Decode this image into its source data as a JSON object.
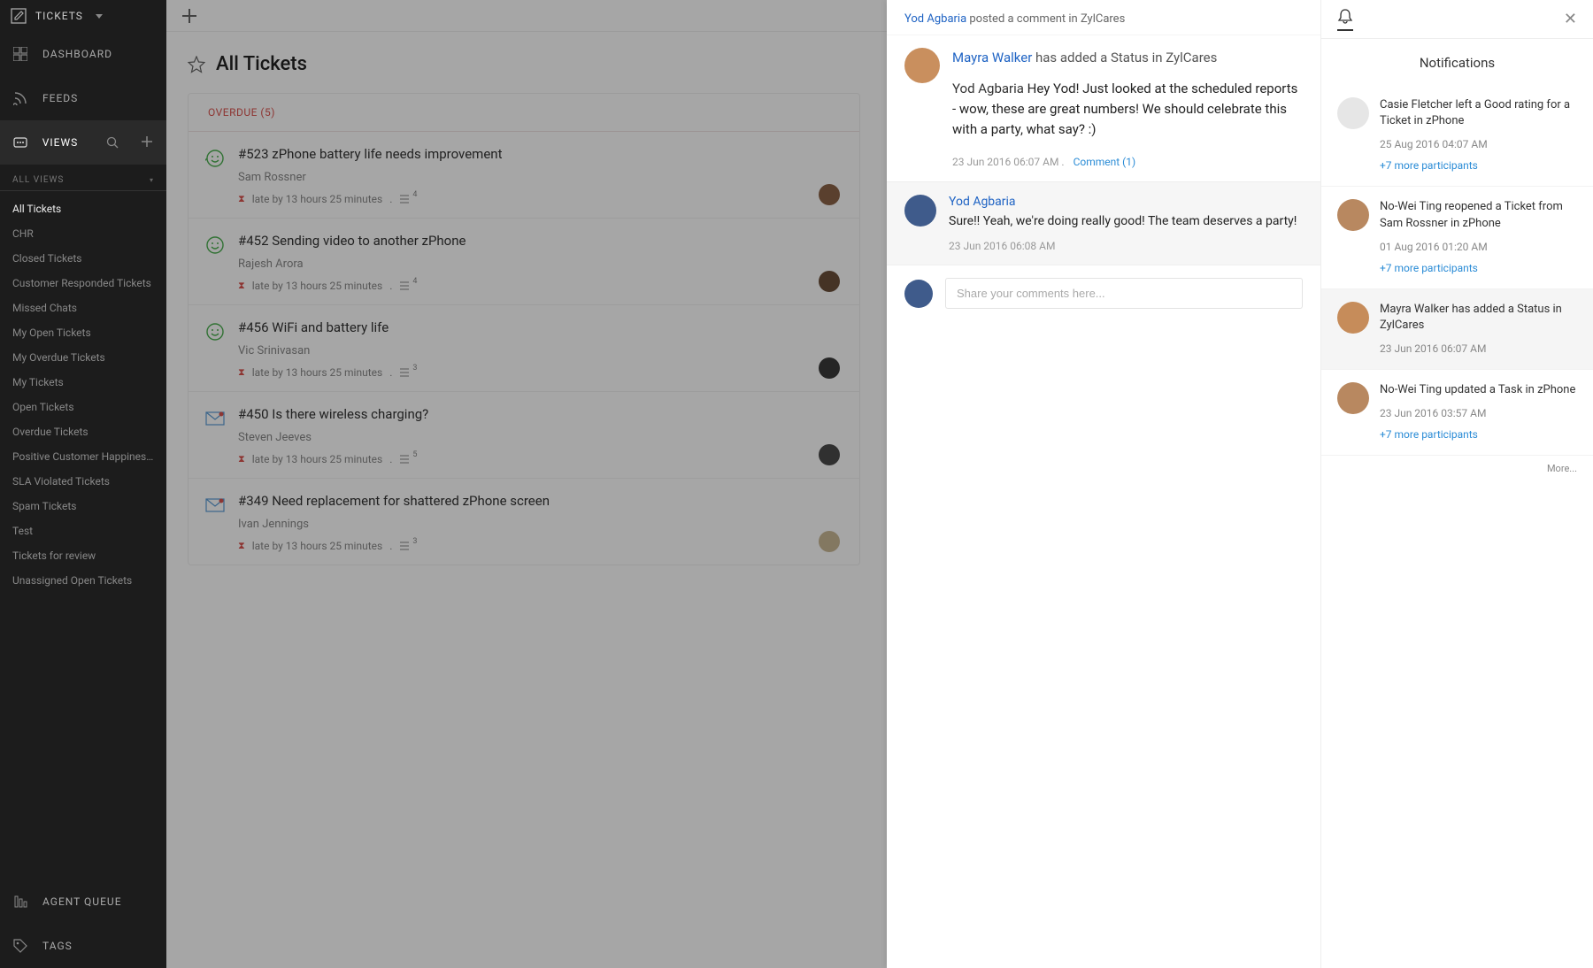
{
  "sidebar": {
    "top_label": "TICKETS",
    "items": [
      {
        "label": "DASHBOARD"
      },
      {
        "label": "FEEDS"
      },
      {
        "label": "VIEWS"
      }
    ],
    "all_views_label": "ALL VIEWS",
    "views": [
      "All Tickets",
      "CHR",
      "Closed Tickets",
      "Customer Responded Tickets",
      "Missed Chats",
      "My Open Tickets",
      "My Overdue Tickets",
      "My Tickets",
      "Open Tickets",
      "Overdue Tickets",
      "Positive Customer Happiness...",
      "SLA Violated Tickets",
      "Spam Tickets",
      "Test",
      "Tickets for review",
      "Unassigned Open Tickets"
    ],
    "bottom": [
      {
        "label": "AGENT QUEUE"
      },
      {
        "label": "TAGS"
      }
    ]
  },
  "main": {
    "title": "All Tickets",
    "overdue_label": "OVERDUE (5)",
    "tickets": [
      {
        "id": "#523",
        "subject": "zPhone battery life needs improvement",
        "requester": "Sam Rossner",
        "late": "late by 13 hours 25 minutes",
        "threads": "4"
      },
      {
        "id": "#452",
        "subject": "Sending video to another zPhone",
        "requester": "Rajesh Arora",
        "late": "late by 13 hours 25 minutes",
        "threads": "4"
      },
      {
        "id": "#456",
        "subject": "WiFi and battery life",
        "requester": "Vic Srinivasan",
        "late": "late by 13 hours 25 minutes",
        "threads": "3"
      },
      {
        "id": "#450",
        "subject": "Is there wireless charging?",
        "requester": "Steven Jeeves",
        "late": "late by 13 hours 25 minutes",
        "threads": "5"
      },
      {
        "id": "#349",
        "subject": "Need replacement for shattered zPhone screen",
        "requester": "Ivan Jennings",
        "late": "late by 13 hours 25 minutes",
        "threads": "3"
      }
    ]
  },
  "thread": {
    "header_name": "Yod Agbaria",
    "header_rest": " posted a comment in ZylCares",
    "status_name": "Mayra Walker",
    "status_rest": " has added a Status in ZylCares",
    "msg_name": "Yod Agbaria",
    "msg_body": " Hey Yod! Just looked at the scheduled reports - wow, these are great numbers! We should celebrate this with a party, what say? :)",
    "msg_time": "23 Jun 2016 06:07 AM .",
    "comment_link": "Comment (1)",
    "reply_name": "Yod Agbaria",
    "reply_text": "Sure!! Yeah, we're doing really good! The team deserves a party!",
    "reply_time": "23 Jun 2016 06:08 AM",
    "input_placeholder": "Share your comments here..."
  },
  "notifications": {
    "title": "Notifications",
    "items": [
      {
        "text": "Casie Fletcher left a Good rating for a Ticket in zPhone",
        "time": "25 Aug 2016 04:07 AM",
        "more": "+7 more participants",
        "avatar": "blank"
      },
      {
        "text": "No-Wei Ting reopened a Ticket from Sam Rossner in zPhone",
        "time": "01 Aug 2016 01:20 AM",
        "more": "+7 more participants",
        "avatar": "photo"
      },
      {
        "text": "Mayra Walker has added a Status in ZylCares",
        "time": "23 Jun 2016 06:07 AM",
        "more": "",
        "avatar": "photo",
        "selected": true
      },
      {
        "text": "No-Wei Ting updated a Task in zPhone",
        "time": "23 Jun 2016 03:57 AM",
        "more": "+7 more participants",
        "avatar": "photo"
      }
    ],
    "more_label": "More..."
  }
}
